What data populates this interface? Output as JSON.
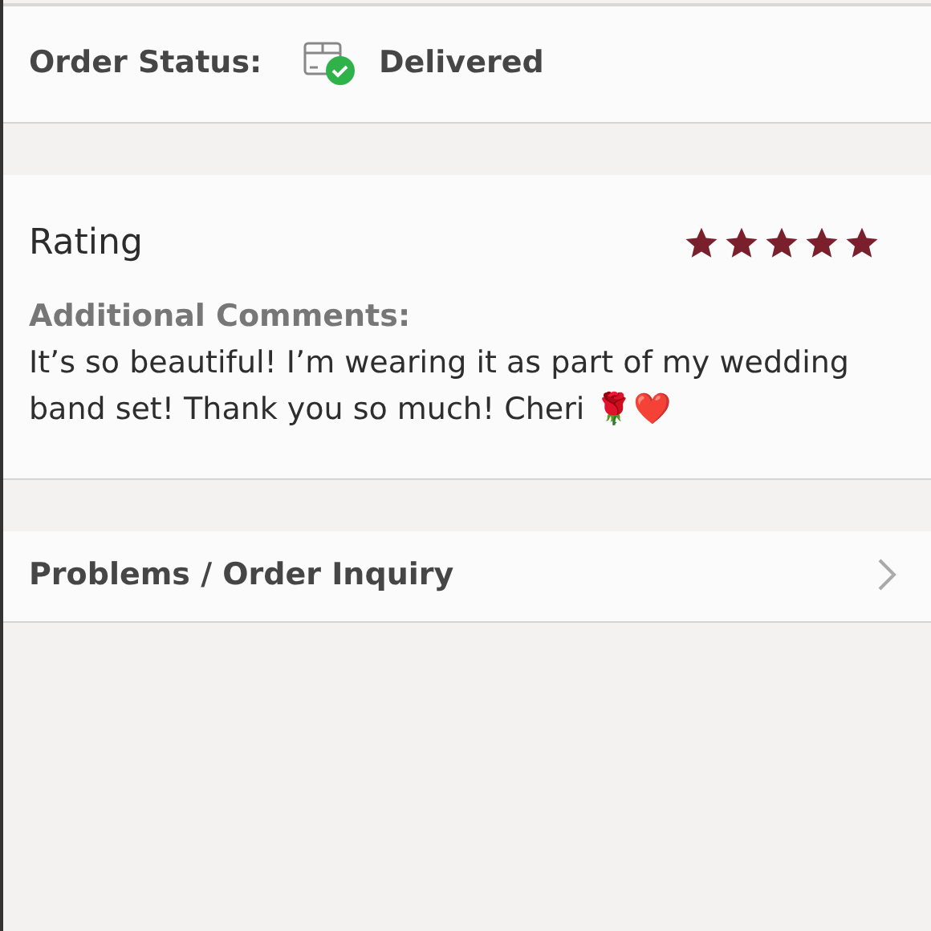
{
  "order_status": {
    "label": "Order Status:",
    "status": "Delivered",
    "delivered": true
  },
  "rating": {
    "label": "Rating",
    "stars": 5
  },
  "comments": {
    "label": "Additional Comments:",
    "text": "It’s so beautiful! I’m wearing it as part of my wedding band set! Thank you so much! Cheri 🌹❤️"
  },
  "inquiry": {
    "label": "Problems / Order Inquiry"
  }
}
